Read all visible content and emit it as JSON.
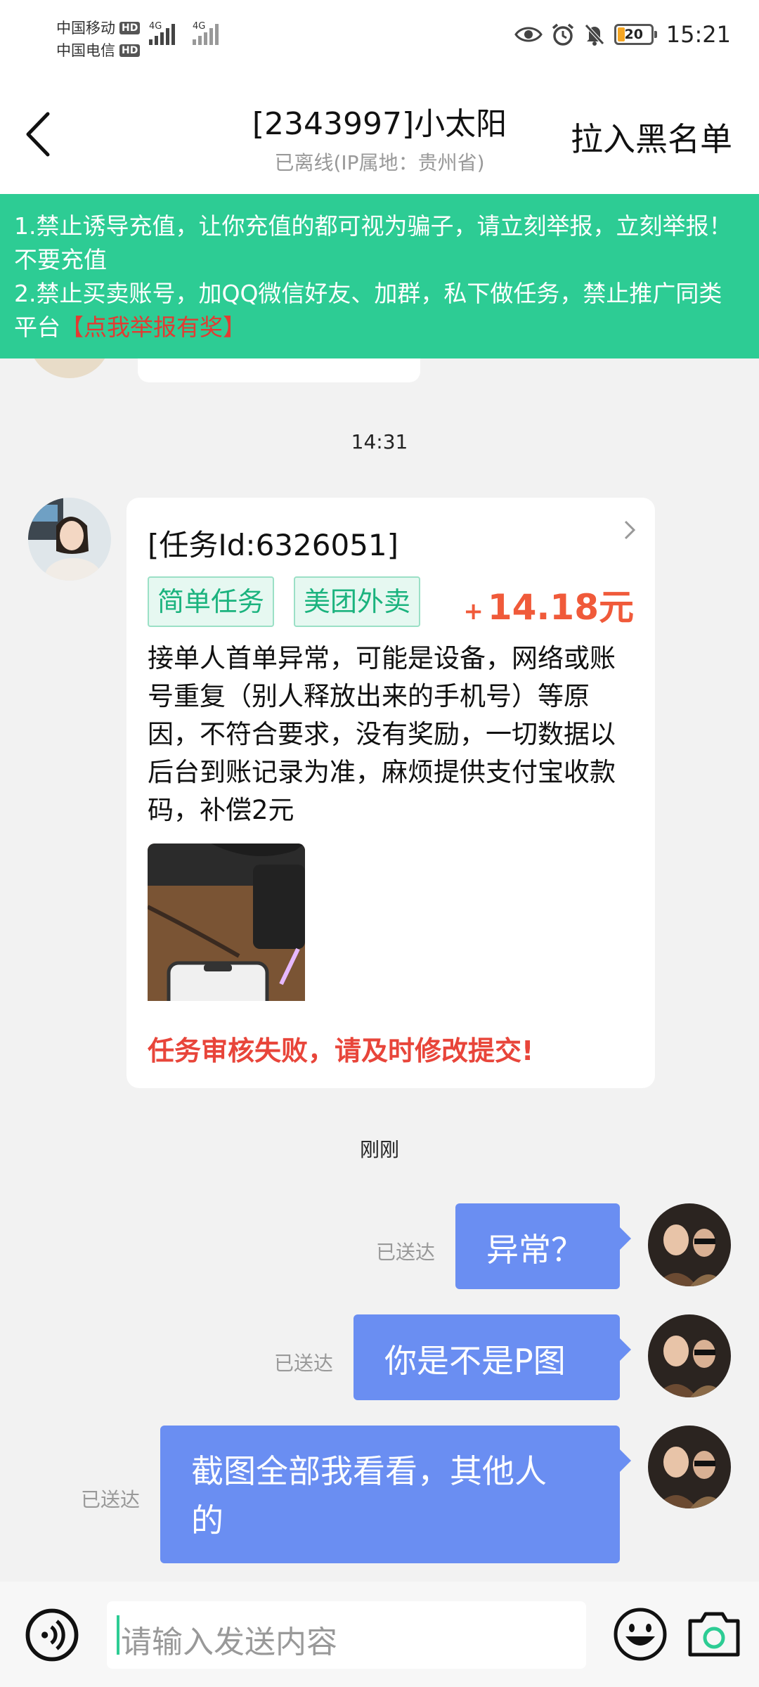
{
  "status_bar": {
    "carrier_1": "中国移动",
    "carrier_2": "中国电信",
    "hd_label": "HD",
    "network_1": "4G",
    "network_2": "4G",
    "battery_level": "20",
    "time": "15:21"
  },
  "header": {
    "title": "[2343997]小太阳",
    "subtitle": "已离线(IP属地：贵州省)",
    "blacklist_label": "拉入黑名单"
  },
  "notice": {
    "line1": "1.禁止诱导充值，让你充值的都可视为骗子，请立刻举报，立刻举报！不要充值",
    "line2": "2.禁止买卖账号，加QQ微信好友、加群，私下做任务，禁止推广同类平台",
    "report_link": "【点我举报有奖】"
  },
  "chat": {
    "timestamp_1": "14:31",
    "task_card": {
      "task_id": "[任务Id:6326051]",
      "tag_1": "简单任务",
      "tag_2": "美团外卖",
      "price_sign": "+",
      "price": "14.18元",
      "body": "接单人首单异常，可能是设备，网络或账号重复（别人释放出来的手机号）等原因，不符合要求，没有奖励，一切数据以后台到账记录为准，麻烦提供支付宝收款码，补偿2元",
      "fail_status": "任务审核失败，请及时修改提交!"
    },
    "timestamp_2": "刚刚",
    "sent_messages": [
      {
        "text": "异常？",
        "status": "已送达"
      },
      {
        "text": "你是不是P图",
        "status": "已送达"
      },
      {
        "text": "截图全部我看看，其他人的",
        "status": "已送达"
      }
    ]
  },
  "input_bar": {
    "placeholder": "请输入发送内容",
    "icons": [
      "voice-icon",
      "emoji-icon",
      "camera-icon"
    ]
  },
  "colors": {
    "accent_green": "#2dcc94",
    "bubble_blue": "#6a8ef2",
    "price_red": "#f05a3a",
    "warning_red": "#e8453a"
  }
}
